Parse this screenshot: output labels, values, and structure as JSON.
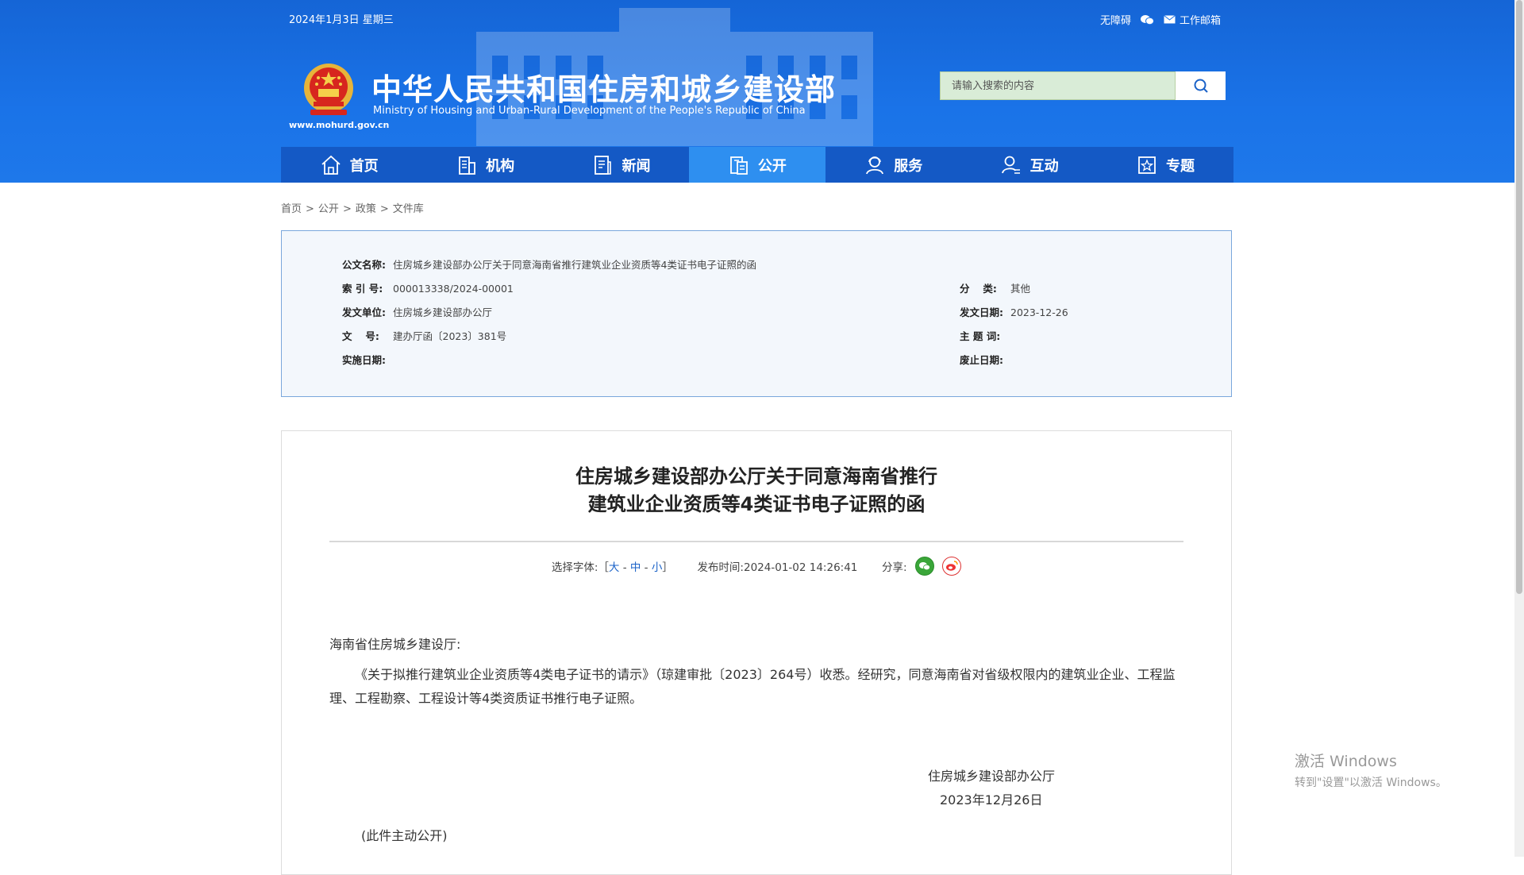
{
  "header": {
    "date": "2024年1月3日 星期三",
    "links": {
      "accessibility": "无障碍",
      "wechat_icon": "wechat-icon",
      "mail": "工作邮箱"
    },
    "site_url": "www.mohurd.gov.cn",
    "title_cn": "中华人民共和国住房和城乡建设部",
    "title_en": "Ministry of Housing and Urban-Rural Development of the People's Republic of China",
    "search_placeholder": "请输入搜索的内容"
  },
  "nav": {
    "items": [
      {
        "label": "首页",
        "icon": "home-icon"
      },
      {
        "label": "机构",
        "icon": "building-icon"
      },
      {
        "label": "新闻",
        "icon": "news-icon"
      },
      {
        "label": "公开",
        "icon": "disclosure-icon",
        "active": true
      },
      {
        "label": "服务",
        "icon": "service-icon"
      },
      {
        "label": "互动",
        "icon": "interaction-icon"
      },
      {
        "label": "专题",
        "icon": "topic-icon"
      }
    ]
  },
  "breadcrumb": [
    "首页",
    "公开",
    "政策",
    "文件库"
  ],
  "meta": {
    "doc_name_label": "公文名称:",
    "doc_name": "住房城乡建设部办公厅关于同意海南省推行建筑业企业资质等4类证书电子证照的函",
    "index_label": "索 引 号:",
    "index": "000013338/2024-00001",
    "category_label": "分　 类:",
    "category": "其他",
    "issuer_label": "发文单位:",
    "issuer": "住房城乡建设部办公厅",
    "issue_date_label": "发文日期:",
    "issue_date": "2023-12-26",
    "doc_no_label": "文　 号:",
    "doc_no": "建办厅函〔2023〕381号",
    "keywords_label": "主 题 词:",
    "keywords": "",
    "effective_label": "实施日期:",
    "effective": "",
    "expire_label": "废止日期:",
    "expire": ""
  },
  "article": {
    "title_line1": "住房城乡建设部办公厅关于同意海南省推行",
    "title_line2": "建筑业企业资质等4类证书电子证照的函",
    "font_label": "选择字体:［",
    "font_large": "大",
    "font_medium": "中",
    "font_small": "小",
    "font_close": "］",
    "publish_label": "发布时间:",
    "publish_time": "2024-01-02 14:26:41",
    "share_label": "分享:",
    "salutation": "海南省住房城乡建设厅:",
    "body": "《关于拟推行建筑业企业资质等4类电子证书的请示》（琼建审批〔2023〕264号）收悉。经研究，同意海南省对省级权限内的建筑业企业、工程监理、工程勘察、工程设计等4类资质证书推行电子证照。",
    "signature_org": "住房城乡建设部办公厅",
    "signature_date": "2023年12月26日",
    "note": "(此件主动公开)"
  },
  "watermark": {
    "line1": "激活 Windows",
    "line2": "转到\"设置\"以激活 Windows。"
  }
}
